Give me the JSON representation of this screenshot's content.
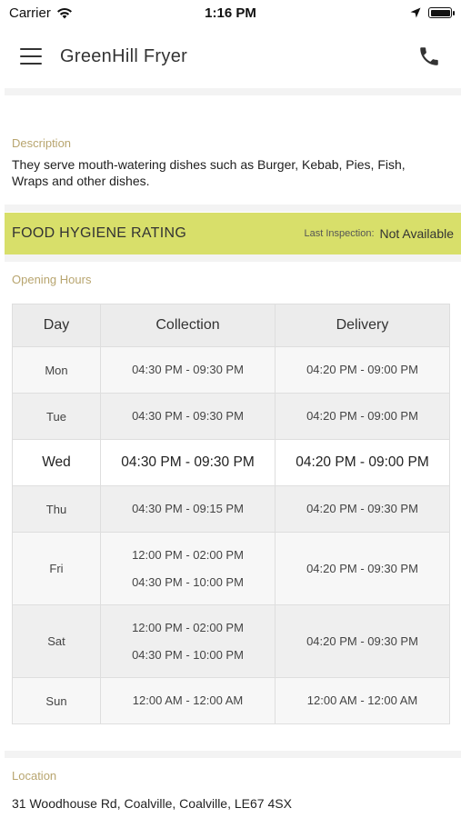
{
  "status_bar": {
    "carrier": "Carrier",
    "time": "1:16 PM"
  },
  "header": {
    "title": "GreenHill Fryer"
  },
  "description": {
    "label": "Description",
    "text": "They serve mouth-watering dishes such as Burger, Kebab, Pies, Fish, Wraps and other dishes."
  },
  "hygiene": {
    "title": "FOOD HYGIENE RATING",
    "inspection_label": "Last Inspection:",
    "inspection_value": "Not Available",
    "bar_color": "#d8df6a"
  },
  "opening_hours": {
    "label": "Opening Hours",
    "columns": [
      "Day",
      "Collection",
      "Delivery"
    ],
    "rows": [
      {
        "day": "Mon",
        "collection": [
          "04:30 PM - 09:30 PM"
        ],
        "delivery": [
          "04:20 PM - 09:00 PM"
        ]
      },
      {
        "day": "Tue",
        "collection": [
          "04:30 PM - 09:30 PM"
        ],
        "delivery": [
          "04:20 PM - 09:00 PM"
        ]
      },
      {
        "day": "Wed",
        "collection": [
          "04:30 PM - 09:30 PM"
        ],
        "delivery": [
          "04:20 PM - 09:00 PM"
        ]
      },
      {
        "day": "Thu",
        "collection": [
          "04:30 PM - 09:15 PM"
        ],
        "delivery": [
          "04:20 PM - 09:30 PM"
        ]
      },
      {
        "day": "Fri",
        "collection": [
          "12:00 PM - 02:00 PM",
          "04:30 PM - 10:00 PM"
        ],
        "delivery": [
          "04:20 PM - 09:30 PM"
        ]
      },
      {
        "day": "Sat",
        "collection": [
          "12:00 PM - 02:00 PM",
          "04:30 PM - 10:00 PM"
        ],
        "delivery": [
          "04:20 PM - 09:30 PM"
        ]
      },
      {
        "day": "Sun",
        "collection": [
          "12:00 AM - 12:00 AM"
        ],
        "delivery": [
          "12:00 AM - 12:00 AM"
        ]
      }
    ]
  },
  "location": {
    "label": "Location",
    "address": "31  Woodhouse Rd, Coalville, Coalville, LE67 4SX"
  },
  "accent_label_color": "#b8a56f"
}
